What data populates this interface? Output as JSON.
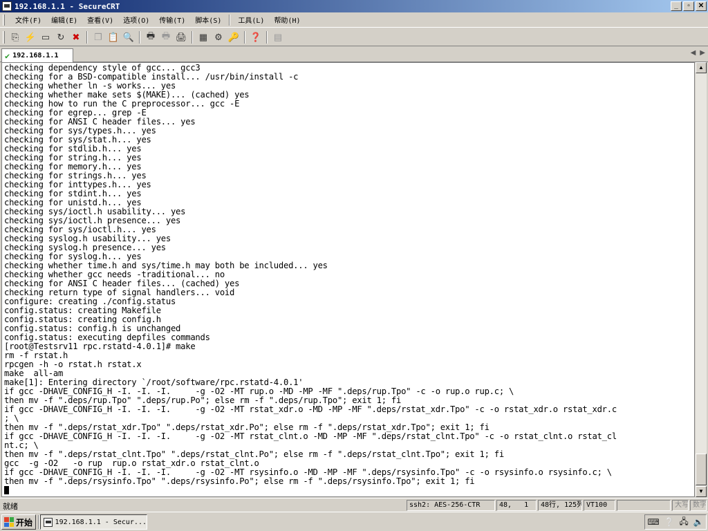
{
  "window": {
    "title": "192.168.1.1 - SecureCRT",
    "minimize": "_",
    "maximize": "▫",
    "close": "✕"
  },
  "menu": [
    "文件(F)",
    "编辑(E)",
    "查看(V)",
    "选项(O)",
    "传输(T)",
    "脚本(S)",
    "工具(L)",
    "帮助(H)"
  ],
  "toolbar_icons": [
    "connect-icon",
    "quick-connect-icon",
    "connect-tab-icon",
    "reconnect-icon",
    "disconnect-icon",
    "copy-icon",
    "paste-icon",
    "find-icon",
    "print-icon",
    "print-selection-icon",
    "print-setup-icon",
    "session-options-icon",
    "global-options-icon",
    "keymap-icon",
    "help-icon",
    "clipboard-icon"
  ],
  "tab": {
    "label": "192.168.1.1"
  },
  "terminal": {
    "lines": [
      "checking dependency style of gcc... gcc3",
      "checking for a BSD-compatible install... /usr/bin/install -c",
      "checking whether ln -s works... yes",
      "checking whether make sets $(MAKE)... (cached) yes",
      "checking how to run the C preprocessor... gcc -E",
      "checking for egrep... grep -E",
      "checking for ANSI C header files... yes",
      "checking for sys/types.h... yes",
      "checking for sys/stat.h... yes",
      "checking for stdlib.h... yes",
      "checking for string.h... yes",
      "checking for memory.h... yes",
      "checking for strings.h... yes",
      "checking for inttypes.h... yes",
      "checking for stdint.h... yes",
      "checking for unistd.h... yes",
      "checking sys/ioctl.h usability... yes",
      "checking sys/ioctl.h presence... yes",
      "checking for sys/ioctl.h... yes",
      "checking syslog.h usability... yes",
      "checking syslog.h presence... yes",
      "checking for syslog.h... yes",
      "checking whether time.h and sys/time.h may both be included... yes",
      "checking whether gcc needs -traditional... no",
      "checking for ANSI C header files... (cached) yes",
      "checking return type of signal handlers... void",
      "configure: creating ./config.status",
      "config.status: creating Makefile",
      "config.status: creating config.h",
      "config.status: config.h is unchanged",
      "config.status: executing depfiles commands",
      "[root@Testsrv11 rpc.rstatd-4.0.1]# make",
      "rm -f rstat.h",
      "rpcgen -h -o rstat.h rstat.x",
      "make  all-am",
      "make[1]: Entering directory `/root/software/rpc.rstatd-4.0.1'",
      "if gcc -DHAVE_CONFIG_H -I. -I. -I.     -g -O2 -MT rup.o -MD -MP -MF \".deps/rup.Tpo\" -c -o rup.o rup.c; \\",
      "then mv -f \".deps/rup.Tpo\" \".deps/rup.Po\"; else rm -f \".deps/rup.Tpo\"; exit 1; fi",
      "if gcc -DHAVE_CONFIG_H -I. -I. -I.     -g -O2 -MT rstat_xdr.o -MD -MP -MF \".deps/rstat_xdr.Tpo\" -c -o rstat_xdr.o rstat_xdr.c",
      "; \\",
      "then mv -f \".deps/rstat_xdr.Tpo\" \".deps/rstat_xdr.Po\"; else rm -f \".deps/rstat_xdr.Tpo\"; exit 1; fi",
      "if gcc -DHAVE_CONFIG_H -I. -I. -I.     -g -O2 -MT rstat_clnt.o -MD -MP -MF \".deps/rstat_clnt.Tpo\" -c -o rstat_clnt.o rstat_cl",
      "nt.c; \\",
      "then mv -f \".deps/rstat_clnt.Tpo\" \".deps/rstat_clnt.Po\"; else rm -f \".deps/rstat_clnt.Tpo\"; exit 1; fi",
      "gcc  -g -O2   -o rup  rup.o rstat_xdr.o rstat_clnt.o",
      "if gcc -DHAVE_CONFIG_H -I. -I. -I.     -g -O2 -MT rsysinfo.o -MD -MP -MF \".deps/rsysinfo.Tpo\" -c -o rsysinfo.o rsysinfo.c; \\",
      "then mv -f \".deps/rsysinfo.Tpo\" \".deps/rsysinfo.Po\"; else rm -f \".deps/rsysinfo.Tpo\"; exit 1; fi"
    ]
  },
  "status": {
    "ready": "就绪",
    "protocol": "ssh2: AES-256-CTR",
    "cursor_pos": "48,   1",
    "dimensions": "48行, 125列",
    "terminal_type": "VT100",
    "caps": "大写",
    "num": "数字"
  },
  "taskbar": {
    "start_label": "开始",
    "task_label": "192.168.1.1 - Secur...",
    "start_logo_colors": [
      "#e0422a",
      "#37a843",
      "#2f6fd6",
      "#f0c419"
    ]
  }
}
